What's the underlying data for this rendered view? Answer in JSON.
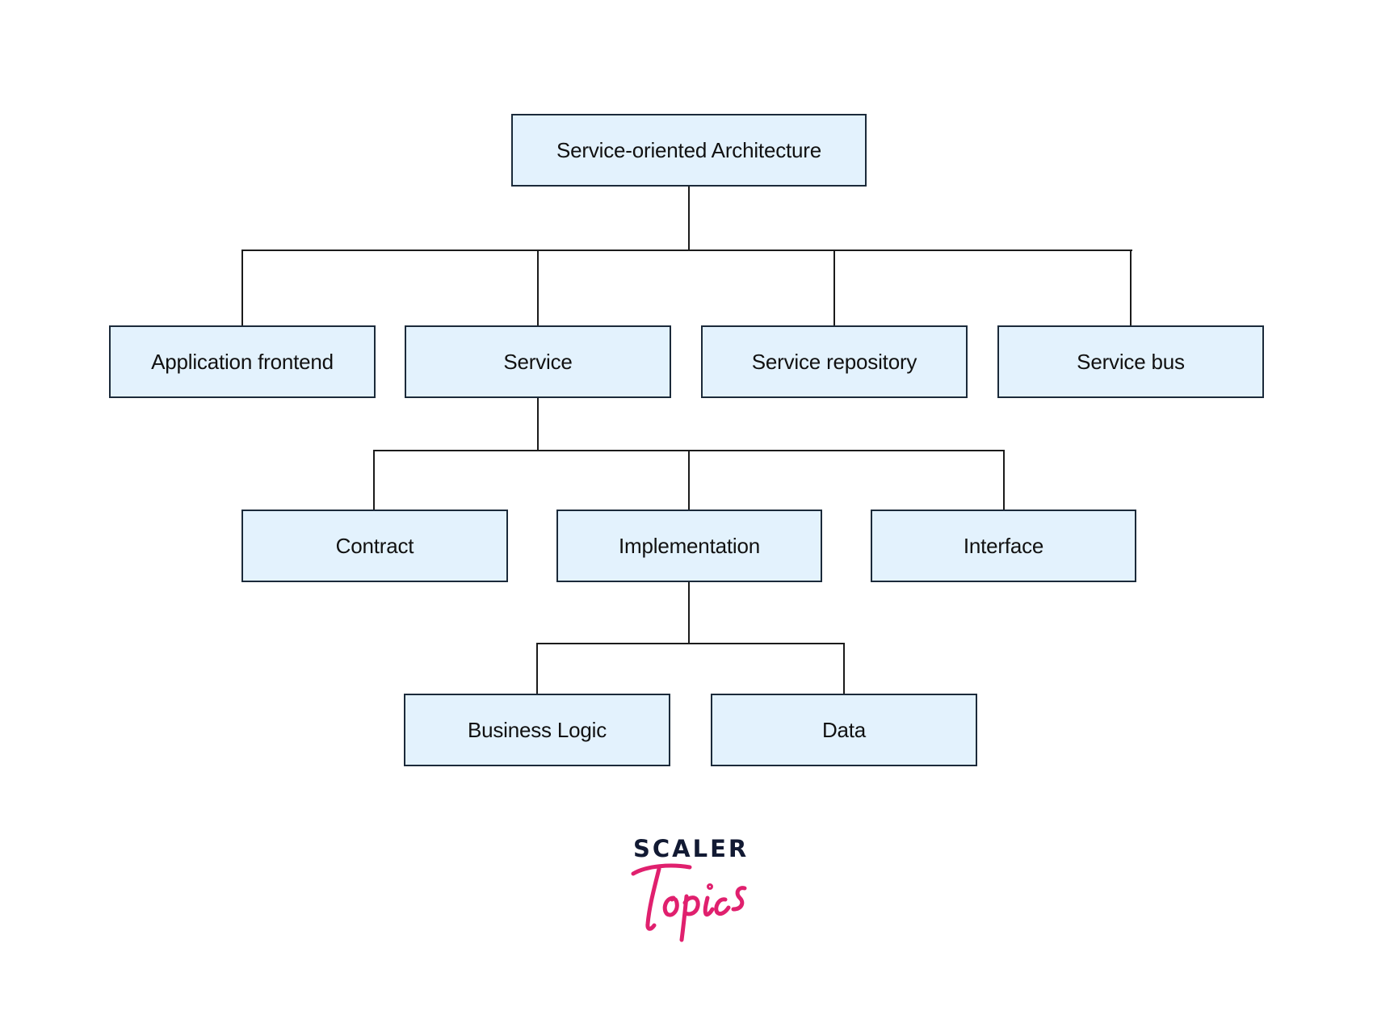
{
  "diagram": {
    "root": {
      "id": "soa",
      "label": "Service-oriented Architecture"
    },
    "level1": [
      {
        "id": "app-frontend",
        "label": "Application frontend",
        "parent": "soa"
      },
      {
        "id": "service",
        "label": "Service",
        "parent": "soa"
      },
      {
        "id": "service-repository",
        "label": "Service repository",
        "parent": "soa"
      },
      {
        "id": "service-bus",
        "label": "Service bus",
        "parent": "soa"
      }
    ],
    "level2": [
      {
        "id": "contract",
        "label": "Contract",
        "parent": "service"
      },
      {
        "id": "implementation",
        "label": "Implementation",
        "parent": "service"
      },
      {
        "id": "interface",
        "label": "Interface",
        "parent": "service"
      }
    ],
    "level3": [
      {
        "id": "business-logic",
        "label": "Business Logic",
        "parent": "implementation"
      },
      {
        "id": "data",
        "label": "Data",
        "parent": "implementation"
      }
    ]
  },
  "colors": {
    "node_fill": "#e3f2fd",
    "node_border": "#1b2a3a",
    "connector": "#1b1b1b",
    "logo_primary": "#121a33",
    "logo_accent": "#e0206e"
  },
  "logo": {
    "brand": "SCALER",
    "sub": "Topics"
  }
}
